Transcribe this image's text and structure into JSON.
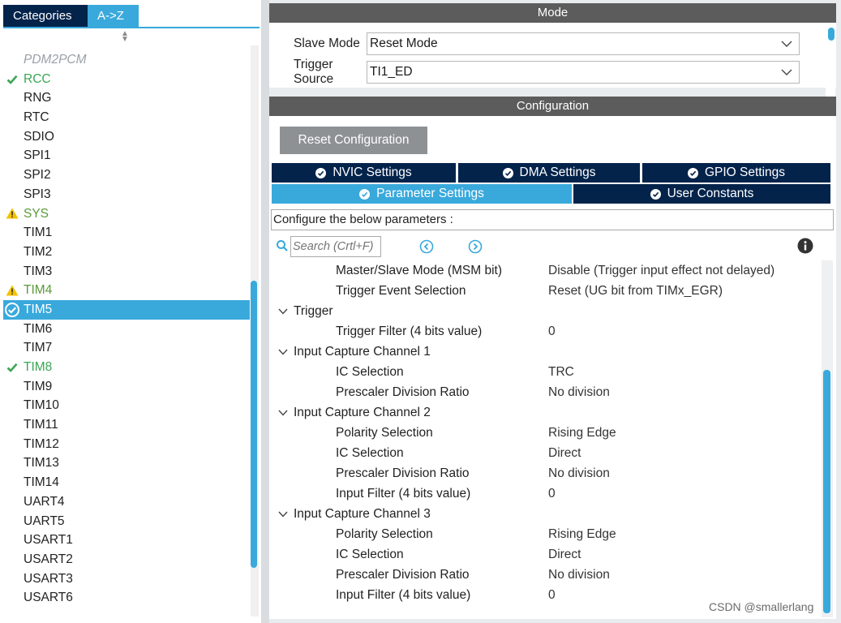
{
  "left_panel": {
    "tabs": [
      {
        "label": "Categories",
        "active": false
      },
      {
        "label": "A->Z",
        "active": true
      }
    ],
    "items": [
      {
        "label": "PDM2PCM",
        "state": "disabled"
      },
      {
        "label": "RCC",
        "state": "configured",
        "icon": "check-icon"
      },
      {
        "label": "RNG",
        "state": "normal"
      },
      {
        "label": "RTC",
        "state": "normal"
      },
      {
        "label": "SDIO",
        "state": "normal"
      },
      {
        "label": "SPI1",
        "state": "normal"
      },
      {
        "label": "SPI2",
        "state": "normal"
      },
      {
        "label": "SPI3",
        "state": "normal"
      },
      {
        "label": "SYS",
        "state": "warning",
        "icon": "warning-icon"
      },
      {
        "label": "TIM1",
        "state": "normal"
      },
      {
        "label": "TIM2",
        "state": "normal"
      },
      {
        "label": "TIM3",
        "state": "normal"
      },
      {
        "label": "TIM4",
        "state": "warning",
        "icon": "warning-icon"
      },
      {
        "label": "TIM5",
        "state": "selected",
        "icon": "check-circle-icon"
      },
      {
        "label": "TIM6",
        "state": "normal"
      },
      {
        "label": "TIM7",
        "state": "normal"
      },
      {
        "label": "TIM8",
        "state": "configured",
        "icon": "check-icon"
      },
      {
        "label": "TIM9",
        "state": "normal"
      },
      {
        "label": "TIM10",
        "state": "normal"
      },
      {
        "label": "TIM11",
        "state": "normal"
      },
      {
        "label": "TIM12",
        "state": "normal"
      },
      {
        "label": "TIM13",
        "state": "normal"
      },
      {
        "label": "TIM14",
        "state": "normal"
      },
      {
        "label": "UART4",
        "state": "normal"
      },
      {
        "label": "UART5",
        "state": "normal"
      },
      {
        "label": "USART1",
        "state": "normal"
      },
      {
        "label": "USART2",
        "state": "normal"
      },
      {
        "label": "USART3",
        "state": "normal"
      },
      {
        "label": "USART6",
        "state": "normal"
      }
    ]
  },
  "mode": {
    "header": "Mode",
    "slave_mode_label": "Slave Mode",
    "slave_mode_value": "Reset Mode",
    "trigger_source_label": "Trigger Source",
    "trigger_source_value": "TI1_ED"
  },
  "configuration": {
    "header": "Configuration",
    "reset_button": "Reset Configuration",
    "tabs_row1": [
      {
        "label": "NVIC Settings",
        "active": false
      },
      {
        "label": "DMA Settings",
        "active": false
      },
      {
        "label": "GPIO Settings",
        "active": false
      }
    ],
    "tabs_row2": [
      {
        "label": "Parameter Settings",
        "active": true
      },
      {
        "label": "User Constants",
        "active": false
      }
    ],
    "describe_text": "Configure the below parameters :",
    "search_placeholder": "Search (Crtl+F)",
    "rows": [
      {
        "kind": "param",
        "name": "Master/Slave Mode (MSM bit)",
        "value": "Disable (Trigger input effect not delayed)"
      },
      {
        "kind": "param",
        "name": "Trigger Event Selection",
        "value": "Reset (UG bit from TIMx_EGR)"
      },
      {
        "kind": "group",
        "name": "Trigger"
      },
      {
        "kind": "param",
        "name": "Trigger Filter (4 bits value)",
        "value": "0"
      },
      {
        "kind": "group",
        "name": "Input Capture Channel 1"
      },
      {
        "kind": "param",
        "name": "IC Selection",
        "value": "TRC"
      },
      {
        "kind": "param",
        "name": "Prescaler Division Ratio",
        "value": "No division"
      },
      {
        "kind": "group",
        "name": "Input Capture Channel 2"
      },
      {
        "kind": "param",
        "name": "Polarity Selection",
        "value": "Rising Edge"
      },
      {
        "kind": "param",
        "name": "IC Selection",
        "value": "Direct"
      },
      {
        "kind": "param",
        "name": "Prescaler Division Ratio",
        "value": "No division"
      },
      {
        "kind": "param",
        "name": "Input Filter (4 bits value)",
        "value": "0"
      },
      {
        "kind": "group",
        "name": "Input Capture Channel 3"
      },
      {
        "kind": "param",
        "name": "Polarity Selection",
        "value": "Rising Edge"
      },
      {
        "kind": "param",
        "name": "IC Selection",
        "value": "Direct"
      },
      {
        "kind": "param",
        "name": "Prescaler Division Ratio",
        "value": "No division"
      },
      {
        "kind": "param",
        "name": "Input Filter (4 bits value)",
        "value": "0"
      }
    ]
  },
  "watermark": "CSDN @smallerlang",
  "colors": {
    "accent": "#39a9dc",
    "navy": "#03234b",
    "section_header": "#5c5c5c",
    "configured_green": "#3aa655",
    "warning_yellow": "#f2c200"
  }
}
